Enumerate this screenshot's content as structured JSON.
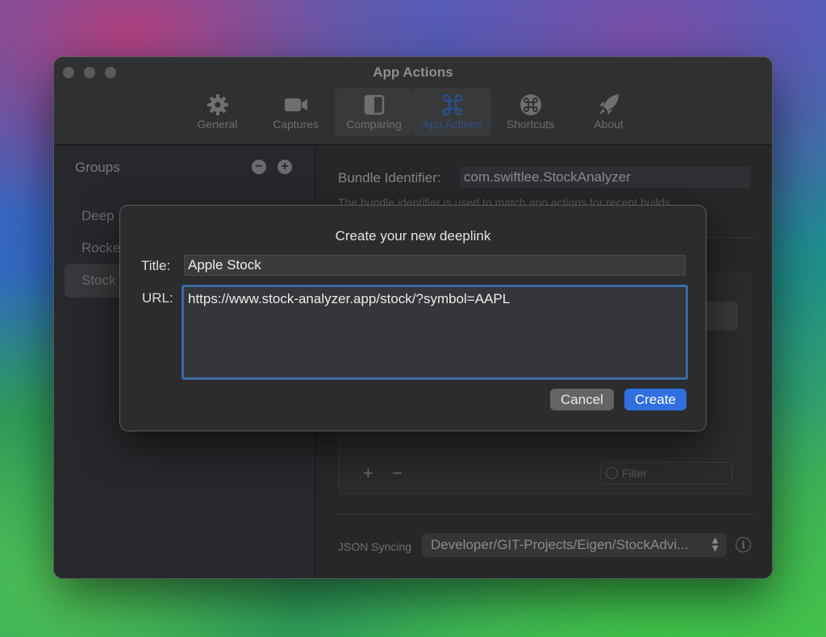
{
  "window": {
    "title": "App Actions",
    "traffic_lights": [
      "close",
      "minimize",
      "zoom"
    ],
    "toolbar": [
      {
        "label": "General",
        "icon": "gear-icon"
      },
      {
        "label": "Captures",
        "icon": "video-camera-icon"
      },
      {
        "label": "Comparing",
        "icon": "split-view-icon"
      },
      {
        "label": "App Actions",
        "icon": "command-icon",
        "selected": true
      },
      {
        "label": "Shortcuts",
        "icon": "command-circle-icon"
      },
      {
        "label": "About",
        "icon": "rocket-icon"
      }
    ]
  },
  "sidebar": {
    "title": "Groups",
    "remove_symbol": "−",
    "add_symbol": "+",
    "items": [
      {
        "label": "Deep"
      },
      {
        "label": "Rocke"
      },
      {
        "label": "Stock",
        "selected": true
      }
    ]
  },
  "content": {
    "bundle_label": "Bundle Identifier:",
    "bundle_value": "com.swiftlee.StockAnalyzer",
    "bundle_hint": "The bundle identifier is used to match app actions for recent builds.",
    "add_symbol": "+",
    "remove_symbol": "−",
    "filter_placeholder": "Filter",
    "json_label": "JSON Syncing",
    "json_value": "Developer/GIT-Projects/Eigen/StockAdvi...",
    "info_symbol": "i"
  },
  "dialog": {
    "title": "Create your new deeplink",
    "title_label": "Title:",
    "title_value": "Apple Stock",
    "url_label": "URL:",
    "url_value": "https://www.stock-analyzer.app/stock/?symbol=AAPL",
    "cancel_label": "Cancel",
    "create_label": "Create"
  },
  "colors": {
    "accent": "#2f6fe0",
    "focus_ring": "#3b6aa3",
    "sheet_bg": "#2b2c2e",
    "window_bg": "#262729"
  }
}
